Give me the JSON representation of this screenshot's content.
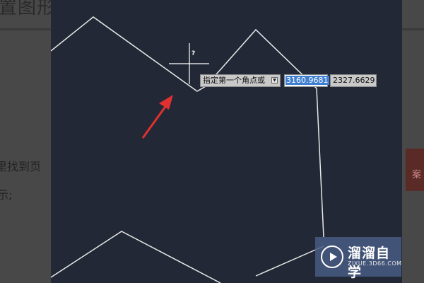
{
  "background": {
    "title_fragment": "置图形",
    "text_line_1": "里找到页",
    "text_line_2": "示;",
    "side_char": "案"
  },
  "command": {
    "prompt": "指定第一个角点或",
    "dropdown_glyph": "▼",
    "x_value": "3160.9681",
    "y_value": "2327.6629"
  },
  "cursor": {
    "glyph": "?"
  },
  "watermark": {
    "name": "溜溜自学",
    "url": "ZIXUE.3D66.COM"
  },
  "colors": {
    "canvas": "#222835",
    "line": "#e8e8e8",
    "arrow": "#e03030",
    "highlight": "#3f7fd1"
  }
}
